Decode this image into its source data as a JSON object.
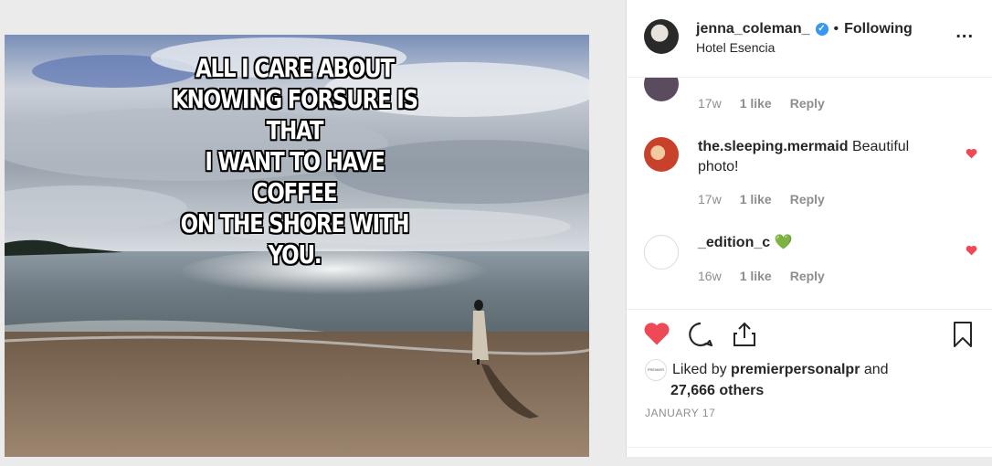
{
  "post": {
    "caption_overlay": [
      "ALL I CARE ABOUT",
      "KNOWING FORSURE IS THAT",
      "I WANT TO HAVE COFFEE",
      "ON THE SHORE WITH YOU."
    ]
  },
  "header": {
    "username": "jenna_coleman_",
    "separator": "•",
    "follow_status": "Following",
    "location": "Hotel Esencia",
    "more": "..."
  },
  "comments": [
    {
      "username": "",
      "text": "",
      "age": "17w",
      "likes": "1 like",
      "reply": "Reply",
      "liked": true,
      "avatar_color": "#5a4b5f"
    },
    {
      "username": "the.sleeping.mermaid",
      "text": " Beautiful photo!",
      "age": "17w",
      "likes": "1 like",
      "reply": "Reply",
      "liked": true,
      "avatar_color": "#c8412b"
    },
    {
      "username": "_edition_c",
      "text": " 💚",
      "age": "16w",
      "likes": "1 like",
      "reply": "Reply",
      "liked": true,
      "avatar_color": "#ffffff"
    }
  ],
  "likes_section": {
    "liked_by_prefix": "Liked by ",
    "liker": "premierpersonalpr",
    "and": " and",
    "others": "27,666 others",
    "avatar_text": "PREMIER"
  },
  "date": "JANUARY 17",
  "colors": {
    "heart": "#ed4956",
    "verified": "#3897f0",
    "meta": "#8e8e8e",
    "text": "#262626"
  }
}
